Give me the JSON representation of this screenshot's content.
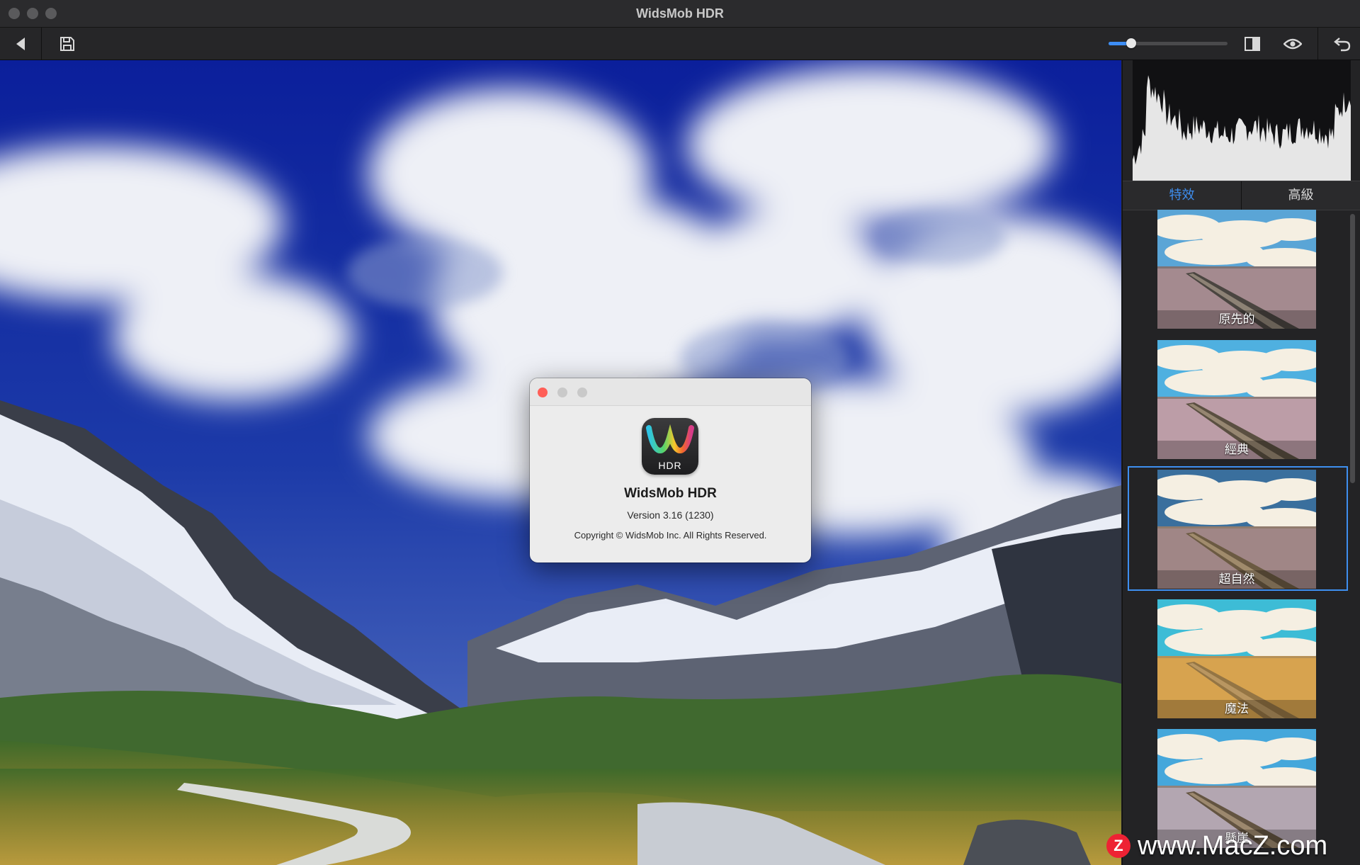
{
  "window": {
    "title": "WidsMob HDR"
  },
  "toolbar": {
    "back": "back-icon",
    "save": "save-icon",
    "zoom": {
      "value": 0.19
    },
    "compare": "split-view-icon",
    "preview": "eye-icon",
    "undo": "undo-icon"
  },
  "panel": {
    "tabs": [
      {
        "label": "特效",
        "active": true
      },
      {
        "label": "高級",
        "active": false
      }
    ],
    "presets": [
      {
        "label": "原先的"
      },
      {
        "label": "經典"
      },
      {
        "label": "超自然",
        "selected": true
      },
      {
        "label": "魔法"
      },
      {
        "label": "懸崖"
      }
    ]
  },
  "about": {
    "app_name": "WidsMob HDR",
    "icon_text": "HDR",
    "version": "Version 3.16 (1230)",
    "copyright": "Copyright © WidsMob Inc. All Rights Reserved."
  },
  "watermark": {
    "logo": "Z",
    "text": "www.MacZ.com"
  },
  "colors": {
    "accent": "#3e8ff0",
    "close": "#ff5f57"
  }
}
